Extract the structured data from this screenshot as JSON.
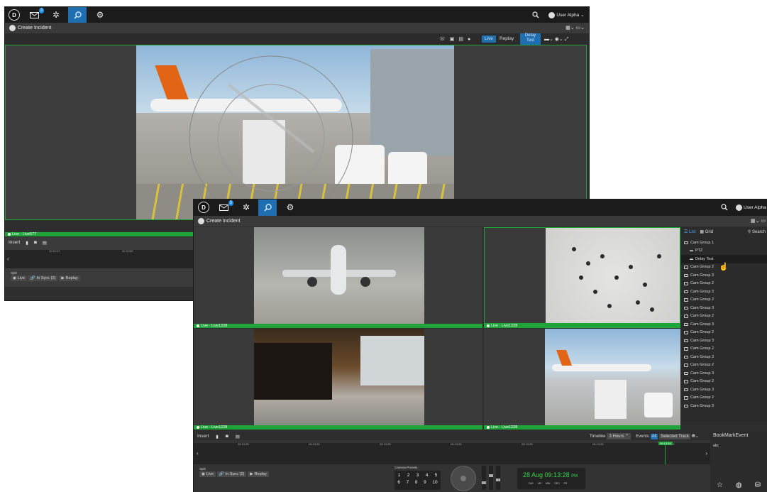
{
  "app": {
    "user_name": "User Alpha",
    "notification_count": "3",
    "create_incident": "Create Incident"
  },
  "back": {
    "toolbar": {
      "live": "Live",
      "replay": "Replay",
      "delay_test": "Delay\nTest"
    },
    "tile_label": "Live - Live577",
    "bottom": {
      "insert": "Insert",
      "split": "Split",
      "live": "Live",
      "in_sync": "In Sync (2)",
      "replay": "Replay"
    },
    "ticks": [
      "11:10:17",
      "11:15:02"
    ]
  },
  "front": {
    "tiles": [
      {
        "label": "Live - Live1228"
      },
      {
        "label": "Live - Live1228"
      },
      {
        "label": "Live - Live1228"
      },
      {
        "label": "Live - Live1228"
      }
    ],
    "panel": {
      "list_tab": "List",
      "grid_tab": "Grid",
      "search": "Search",
      "items": [
        {
          "label": "Cam Group 1",
          "kind": "folder"
        },
        {
          "label": "PTZ",
          "kind": "camera"
        },
        {
          "label": "Delay Test",
          "kind": "camera"
        },
        {
          "label": "Cam Group 2",
          "kind": "folder"
        },
        {
          "label": "Cam Group 3",
          "kind": "folder"
        },
        {
          "label": "Cam Group 2",
          "kind": "folder"
        },
        {
          "label": "Cam Group 3",
          "kind": "folder"
        },
        {
          "label": "Cam Group 2",
          "kind": "folder"
        },
        {
          "label": "Cam Group 3",
          "kind": "folder"
        },
        {
          "label": "Cam Group 2",
          "kind": "folder"
        },
        {
          "label": "Cam Group 3",
          "kind": "folder"
        },
        {
          "label": "Cam Group 2",
          "kind": "folder"
        },
        {
          "label": "Cam Group 3",
          "kind": "folder"
        },
        {
          "label": "Cam Group 2",
          "kind": "folder"
        },
        {
          "label": "Cam Group 3",
          "kind": "folder"
        },
        {
          "label": "Cam Group 2",
          "kind": "folder"
        },
        {
          "label": "Cam Group 3",
          "kind": "folder"
        },
        {
          "label": "Cam Group 2",
          "kind": "folder"
        },
        {
          "label": "Cam Group 3",
          "kind": "folder"
        },
        {
          "label": "Cam Group 2",
          "kind": "folder"
        },
        {
          "label": "Cam Group 3",
          "kind": "folder"
        }
      ]
    },
    "timeline": {
      "insert": "Insert",
      "timeline_label": "Timeline",
      "hours": "3 Hours",
      "events": "Events",
      "all": "All",
      "selected_track": "Selected Track",
      "ticks": [
        "09:13:25",
        "09:13:25",
        "09:13:25",
        "09:13:25",
        "09:13:25",
        "09:13:25",
        "09:13:25"
      ],
      "current": "09:13:28"
    },
    "bookmark": {
      "title": "BookMarkEvent",
      "text": "abc"
    },
    "bottom": {
      "split": "Split",
      "live": "Live",
      "in_sync": "In Sync (2)",
      "replay": "Replay",
      "presets_title": "Camera Presets",
      "presets_row1": [
        "1",
        "2",
        "3",
        "4",
        "5"
      ],
      "presets_row2": [
        "6",
        "7",
        "8",
        "9",
        "10"
      ],
      "date": "28 Aug",
      "time": "09:13:28",
      "ampm": "PM",
      "labels": [
        "DAY",
        "HR",
        "MIN",
        "SEC",
        "FR"
      ]
    }
  },
  "colors": {
    "accent": "#1f6fb0",
    "live_green": "#1fa43a",
    "clock_green": "#38d64a"
  }
}
